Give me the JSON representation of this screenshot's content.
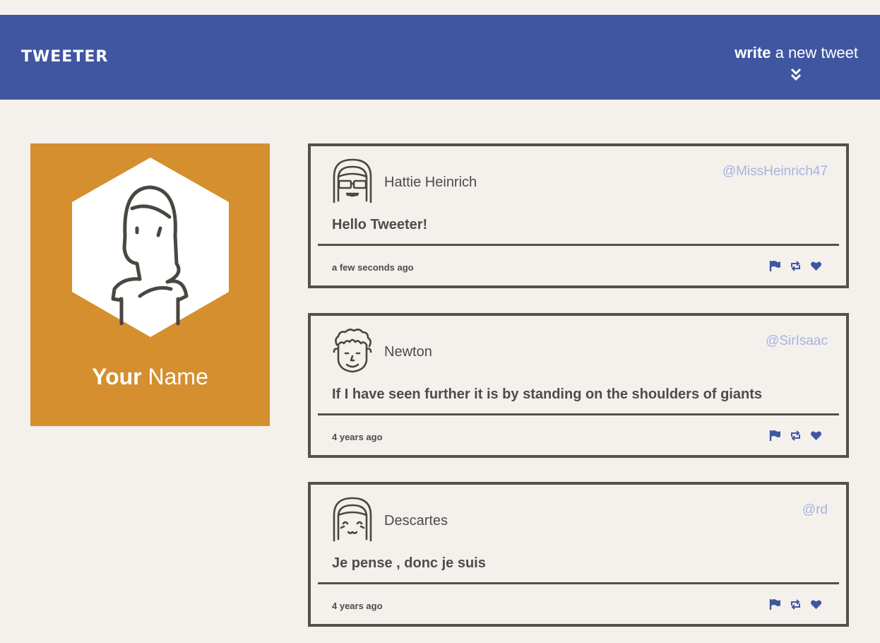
{
  "header": {
    "brand": "TWEETER",
    "compose_bold": "write",
    "compose_rest": " a new tweet"
  },
  "profile": {
    "name_bold": "Your",
    "name_rest": " Name"
  },
  "colors": {
    "nav": "#4056a1",
    "profile_bg": "#d58f2e",
    "page_bg": "#f4f1ec",
    "border": "#555049",
    "accent": "#4056a1",
    "handle": "#a9b1e0"
  },
  "tweets": [
    {
      "name": "Hattie Heinrich",
      "handle": "@MissHeinrich47",
      "content": "Hello Tweeter!",
      "time": "a few seconds ago",
      "avatar_icon": "girl-sunglasses-icon"
    },
    {
      "name": "Newton",
      "handle": "@SirIsaac",
      "content": "If I have seen further it is by standing on the shoulders of giants",
      "time": "4 years ago",
      "avatar_icon": "curly-hair-man-icon"
    },
    {
      "name": "Descartes",
      "handle": "@rd",
      "content": "Je pense , donc je suis",
      "time": "4 years ago",
      "avatar_icon": "smiling-girl-icon"
    }
  ],
  "icons": [
    "flag-icon",
    "retweet-icon",
    "heart-icon",
    "double-chevron-down-icon"
  ]
}
